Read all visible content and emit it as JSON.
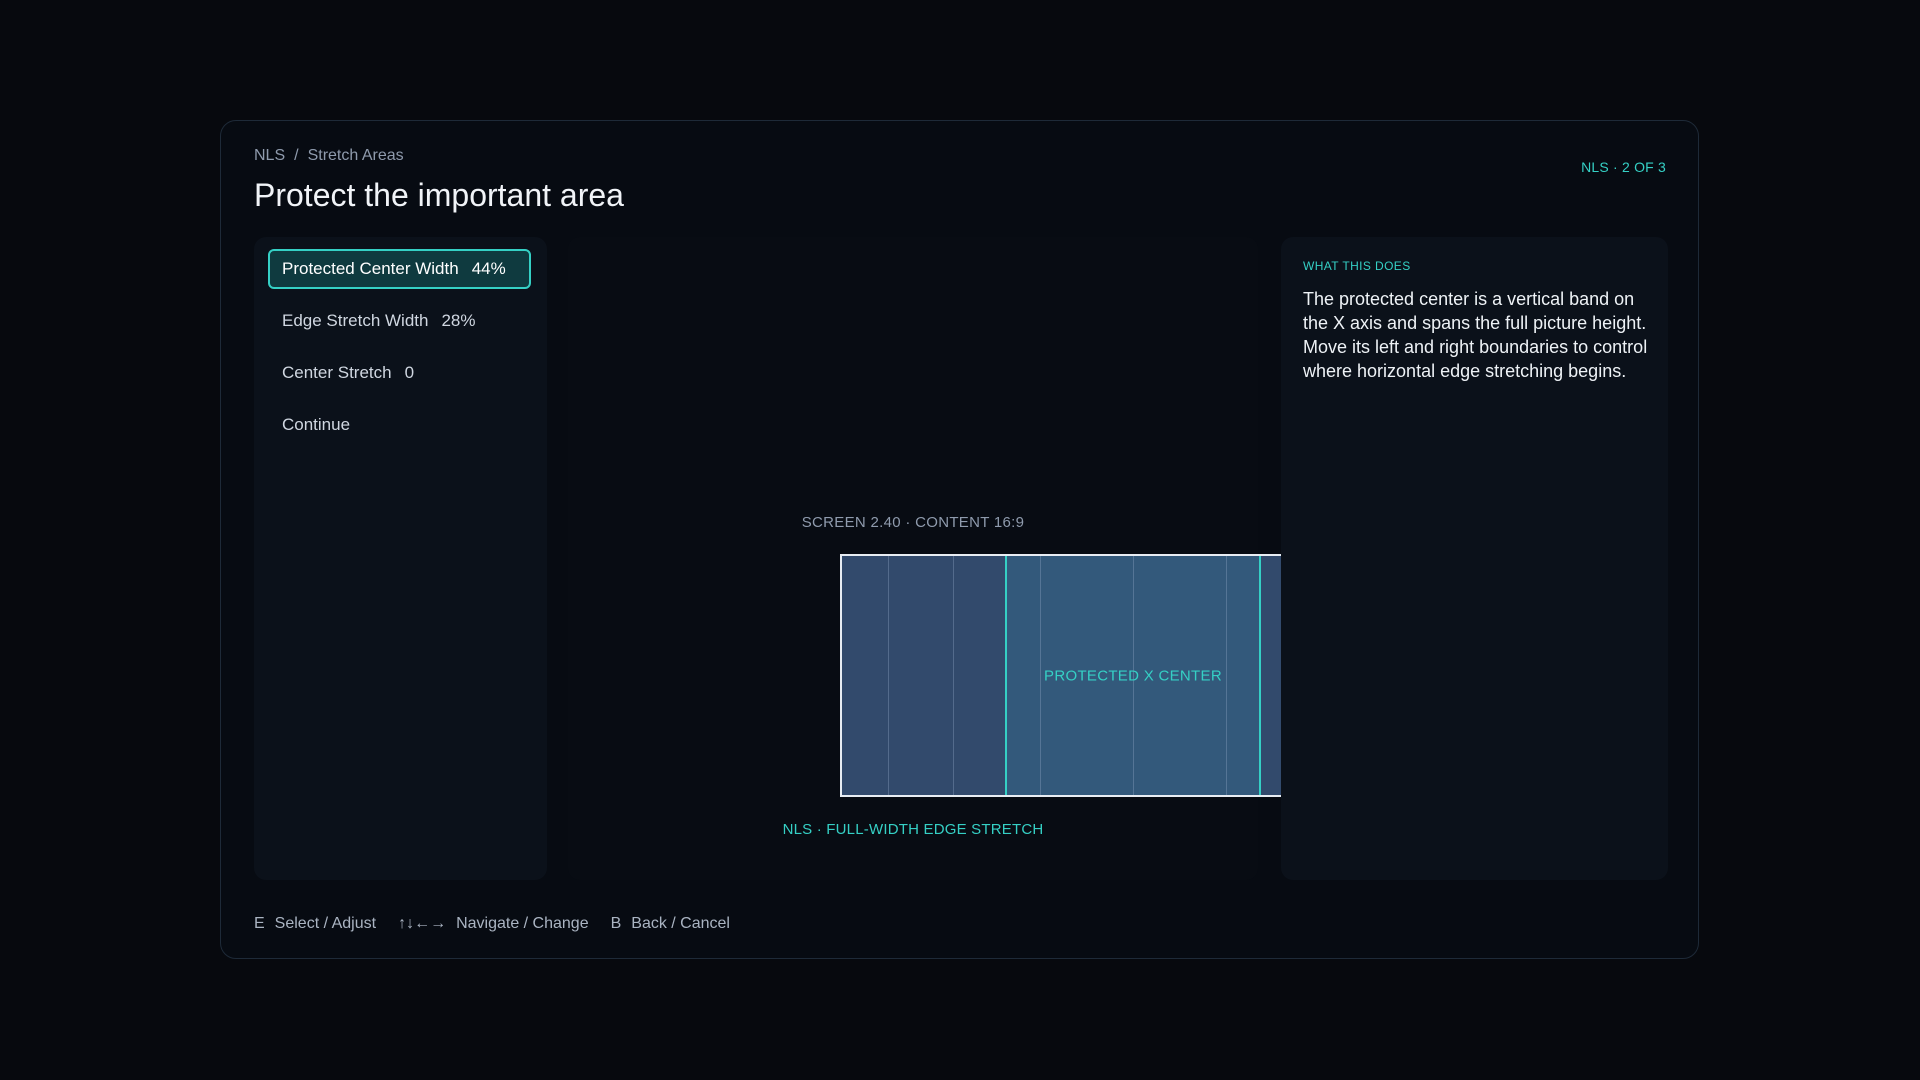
{
  "header": {
    "breadcrumb": [
      "NLS",
      "Stretch Areas"
    ],
    "breadcrumb_separator": "/",
    "step": "NLS · 2 OF 3",
    "title": "Protect the important area"
  },
  "menu": {
    "items": [
      {
        "label": "Protected Center Width",
        "value": "44%",
        "active": true
      },
      {
        "label": "Edge Stretch Width",
        "value": "28%",
        "active": false
      },
      {
        "label": "Center Stretch",
        "value": "0",
        "active": false
      },
      {
        "label": "Continue",
        "value": "",
        "active": false
      }
    ]
  },
  "preview": {
    "screen_label": "SCREEN 2.40  ·  CONTENT 16:9",
    "center_label": "PROTECTED X CENTER",
    "mode_label": "NLS · FULL-WIDTH EDGE STRETCH",
    "protected_center_width_pct": 44,
    "edge_stretch_width_pct": 28,
    "colors": {
      "accent": "#35d0c5",
      "edge_zone": "#324a6c",
      "center_zone": "#33597b"
    }
  },
  "info": {
    "heading": "WHAT THIS DOES",
    "body": "The protected center is a vertical band on the X axis and spans the full picture height. Move its left and right boundaries to control where horizontal edge stretching begins."
  },
  "footer": {
    "hints": [
      {
        "key": "E",
        "label": "Select / Adjust"
      },
      {
        "key": "↑↓←→",
        "label": "Navigate / Change"
      },
      {
        "key": "B",
        "label": "Back / Cancel"
      }
    ]
  }
}
